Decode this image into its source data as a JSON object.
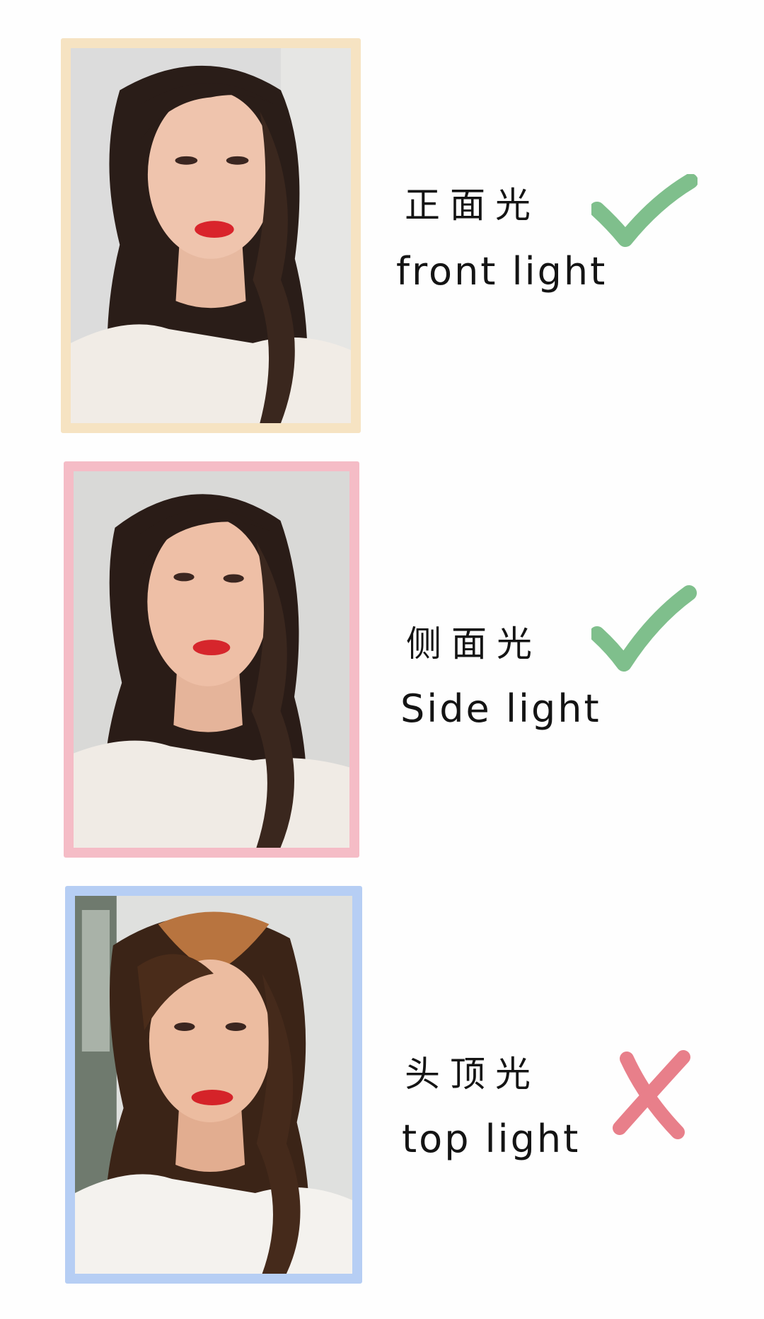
{
  "items": [
    {
      "cn": "正面光",
      "en": "front light",
      "verdict": "check",
      "frame_color": "#f6e3c2",
      "mark_color": "#7fbf8c",
      "photo_alt": "portrait lit from the front"
    },
    {
      "cn": "侧面光",
      "en": "Side light",
      "verdict": "check",
      "frame_color": "#f5bcc6",
      "mark_color": "#7fbf8c",
      "photo_alt": "portrait lit from the side"
    },
    {
      "cn": "头顶光",
      "en": "top light",
      "verdict": "cross",
      "frame_color": "#b6cef4",
      "mark_color": "#e87f8a",
      "photo_alt": "portrait lit from above"
    }
  ]
}
